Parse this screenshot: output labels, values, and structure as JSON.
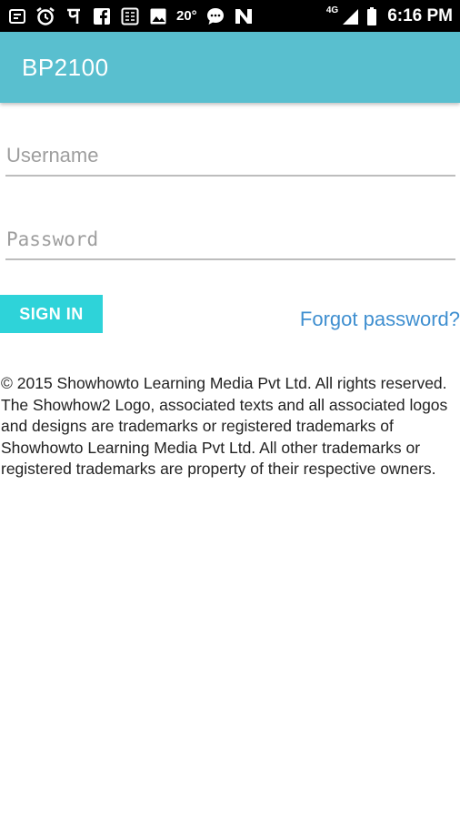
{
  "status_bar": {
    "temperature": "20°",
    "network": "4G",
    "time": "6:16 PM",
    "icons": [
      "screen-record-icon",
      "alarm-icon",
      "pe-app-icon",
      "facebook-icon",
      "calculator-icon",
      "image-icon",
      "chat-icon",
      "app-notification-icon",
      "signal-icon",
      "battery-icon"
    ]
  },
  "app_bar": {
    "title": "BP2100"
  },
  "form": {
    "username_placeholder": "Username",
    "password_placeholder": "Password",
    "sign_in_label": "SIGN IN",
    "forgot_label": "Forgot password?"
  },
  "footer": {
    "copyright": "© 2015 Showhowto Learning Media Pvt Ltd. All rights reserved. The Showhow2 Logo, associated texts and all associated logos and designs are trademarks or registered trademarks of Showhowto Learning Media Pvt Ltd. All other trademarks or registered trademarks are property of their respective owners."
  },
  "colors": {
    "app_bar": "#59bfcf",
    "sign_in": "#2ed3d9",
    "link": "#3f8fd0"
  }
}
